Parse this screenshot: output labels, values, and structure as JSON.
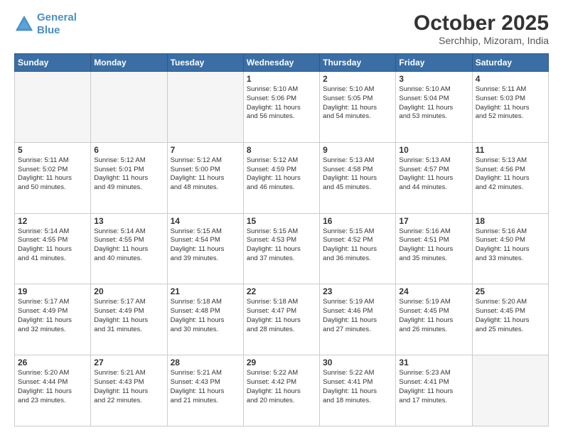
{
  "header": {
    "logo_line1": "General",
    "logo_line2": "Blue",
    "month": "October 2025",
    "location": "Serchhip, Mizoram, India"
  },
  "weekdays": [
    "Sunday",
    "Monday",
    "Tuesday",
    "Wednesday",
    "Thursday",
    "Friday",
    "Saturday"
  ],
  "weeks": [
    [
      {
        "day": "",
        "info": ""
      },
      {
        "day": "",
        "info": ""
      },
      {
        "day": "",
        "info": ""
      },
      {
        "day": "1",
        "info": "Sunrise: 5:10 AM\nSunset: 5:06 PM\nDaylight: 11 hours\nand 56 minutes."
      },
      {
        "day": "2",
        "info": "Sunrise: 5:10 AM\nSunset: 5:05 PM\nDaylight: 11 hours\nand 54 minutes."
      },
      {
        "day": "3",
        "info": "Sunrise: 5:10 AM\nSunset: 5:04 PM\nDaylight: 11 hours\nand 53 minutes."
      },
      {
        "day": "4",
        "info": "Sunrise: 5:11 AM\nSunset: 5:03 PM\nDaylight: 11 hours\nand 52 minutes."
      }
    ],
    [
      {
        "day": "5",
        "info": "Sunrise: 5:11 AM\nSunset: 5:02 PM\nDaylight: 11 hours\nand 50 minutes."
      },
      {
        "day": "6",
        "info": "Sunrise: 5:12 AM\nSunset: 5:01 PM\nDaylight: 11 hours\nand 49 minutes."
      },
      {
        "day": "7",
        "info": "Sunrise: 5:12 AM\nSunset: 5:00 PM\nDaylight: 11 hours\nand 48 minutes."
      },
      {
        "day": "8",
        "info": "Sunrise: 5:12 AM\nSunset: 4:59 PM\nDaylight: 11 hours\nand 46 minutes."
      },
      {
        "day": "9",
        "info": "Sunrise: 5:13 AM\nSunset: 4:58 PM\nDaylight: 11 hours\nand 45 minutes."
      },
      {
        "day": "10",
        "info": "Sunrise: 5:13 AM\nSunset: 4:57 PM\nDaylight: 11 hours\nand 44 minutes."
      },
      {
        "day": "11",
        "info": "Sunrise: 5:13 AM\nSunset: 4:56 PM\nDaylight: 11 hours\nand 42 minutes."
      }
    ],
    [
      {
        "day": "12",
        "info": "Sunrise: 5:14 AM\nSunset: 4:55 PM\nDaylight: 11 hours\nand 41 minutes."
      },
      {
        "day": "13",
        "info": "Sunrise: 5:14 AM\nSunset: 4:55 PM\nDaylight: 11 hours\nand 40 minutes."
      },
      {
        "day": "14",
        "info": "Sunrise: 5:15 AM\nSunset: 4:54 PM\nDaylight: 11 hours\nand 39 minutes."
      },
      {
        "day": "15",
        "info": "Sunrise: 5:15 AM\nSunset: 4:53 PM\nDaylight: 11 hours\nand 37 minutes."
      },
      {
        "day": "16",
        "info": "Sunrise: 5:15 AM\nSunset: 4:52 PM\nDaylight: 11 hours\nand 36 minutes."
      },
      {
        "day": "17",
        "info": "Sunrise: 5:16 AM\nSunset: 4:51 PM\nDaylight: 11 hours\nand 35 minutes."
      },
      {
        "day": "18",
        "info": "Sunrise: 5:16 AM\nSunset: 4:50 PM\nDaylight: 11 hours\nand 33 minutes."
      }
    ],
    [
      {
        "day": "19",
        "info": "Sunrise: 5:17 AM\nSunset: 4:49 PM\nDaylight: 11 hours\nand 32 minutes."
      },
      {
        "day": "20",
        "info": "Sunrise: 5:17 AM\nSunset: 4:49 PM\nDaylight: 11 hours\nand 31 minutes."
      },
      {
        "day": "21",
        "info": "Sunrise: 5:18 AM\nSunset: 4:48 PM\nDaylight: 11 hours\nand 30 minutes."
      },
      {
        "day": "22",
        "info": "Sunrise: 5:18 AM\nSunset: 4:47 PM\nDaylight: 11 hours\nand 28 minutes."
      },
      {
        "day": "23",
        "info": "Sunrise: 5:19 AM\nSunset: 4:46 PM\nDaylight: 11 hours\nand 27 minutes."
      },
      {
        "day": "24",
        "info": "Sunrise: 5:19 AM\nSunset: 4:45 PM\nDaylight: 11 hours\nand 26 minutes."
      },
      {
        "day": "25",
        "info": "Sunrise: 5:20 AM\nSunset: 4:45 PM\nDaylight: 11 hours\nand 25 minutes."
      }
    ],
    [
      {
        "day": "26",
        "info": "Sunrise: 5:20 AM\nSunset: 4:44 PM\nDaylight: 11 hours\nand 23 minutes."
      },
      {
        "day": "27",
        "info": "Sunrise: 5:21 AM\nSunset: 4:43 PM\nDaylight: 11 hours\nand 22 minutes."
      },
      {
        "day": "28",
        "info": "Sunrise: 5:21 AM\nSunset: 4:43 PM\nDaylight: 11 hours\nand 21 minutes."
      },
      {
        "day": "29",
        "info": "Sunrise: 5:22 AM\nSunset: 4:42 PM\nDaylight: 11 hours\nand 20 minutes."
      },
      {
        "day": "30",
        "info": "Sunrise: 5:22 AM\nSunset: 4:41 PM\nDaylight: 11 hours\nand 18 minutes."
      },
      {
        "day": "31",
        "info": "Sunrise: 5:23 AM\nSunset: 4:41 PM\nDaylight: 11 hours\nand 17 minutes."
      },
      {
        "day": "",
        "info": ""
      }
    ]
  ]
}
